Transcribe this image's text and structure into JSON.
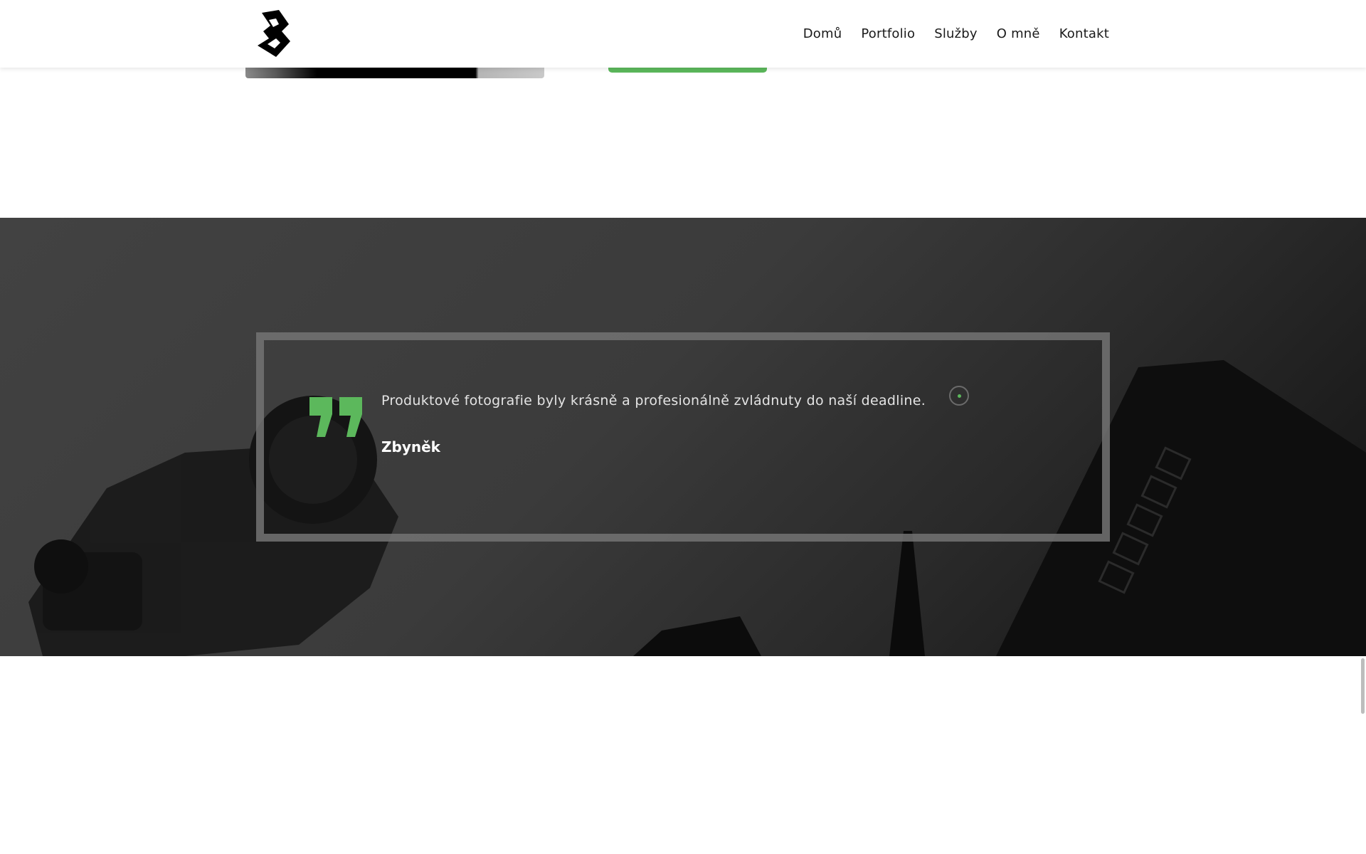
{
  "nav": {
    "items": [
      {
        "label": "Domů"
      },
      {
        "label": "Portfolio"
      },
      {
        "label": "Služby"
      },
      {
        "label": "O mně"
      },
      {
        "label": "Kontakt"
      }
    ]
  },
  "testimonial": {
    "quote": "Produktové fotografie byly krásně a profesionálně zvládnuty do naší deadline.",
    "author": "Zbyněk"
  },
  "colors": {
    "accent": "#5cb85c",
    "section_bg": "#3c3c3c",
    "header_bg": "#ffffff"
  },
  "icons": [
    "logo-b-icon",
    "quote-icon",
    "slider-dot-icon"
  ]
}
